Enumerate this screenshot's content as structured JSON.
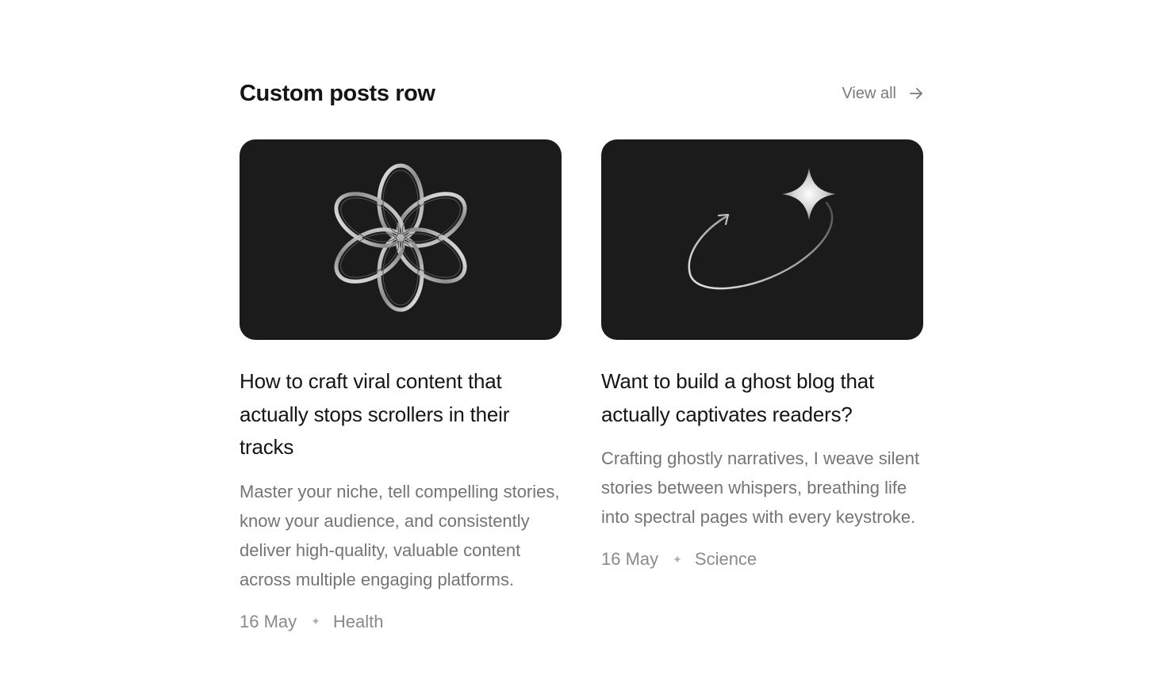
{
  "section": {
    "title": "Custom posts row",
    "view_all_label": "View all"
  },
  "posts": [
    {
      "title": "How to craft viral content that actually stops scrollers in their tracks",
      "excerpt": "Master your niche, tell compelling stories, know your audience, and consistently deliver high-quality, valuable content across multiple engaging platforms.",
      "date": "16 May",
      "separator": "✦",
      "tag": "Health",
      "image_icon": "flower-icon"
    },
    {
      "title": "Want to build a ghost blog that actually captivates readers?",
      "excerpt": "Crafting ghostly narratives, I weave silent stories between whispers, breathing life into spectral pages with every keystroke.",
      "date": "16 May",
      "separator": "✦",
      "tag": "Science",
      "image_icon": "sparkle-orbit-icon"
    }
  ],
  "colors": {
    "thumb_background": "#1b1b1b",
    "title": "#151515",
    "muted": "#747474"
  }
}
